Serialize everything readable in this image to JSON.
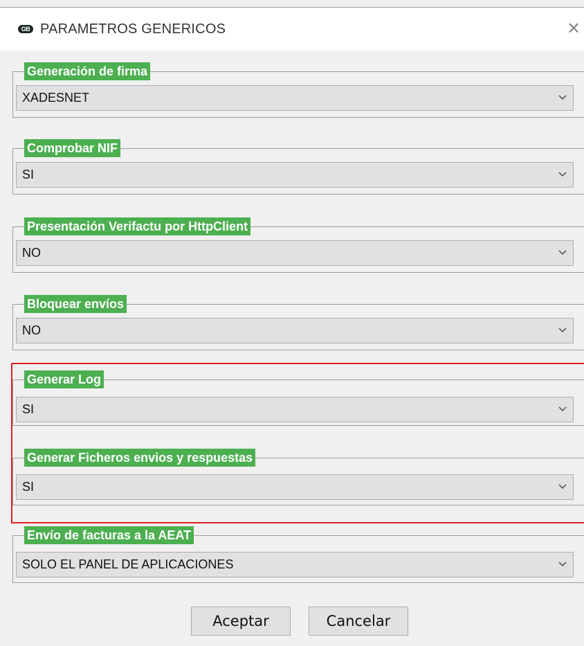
{
  "window": {
    "title": "PARAMETROS GENERICOS",
    "app_icon_text": "GB",
    "close_icon": "close-icon"
  },
  "fields": [
    {
      "label": "Generación de firma",
      "value": "XADESNET"
    },
    {
      "label": "Comprobar NIF",
      "value": "SI"
    },
    {
      "label": "Presentación Verifactu por HttpClient",
      "value": "NO"
    },
    {
      "label": "Bloquear envíos",
      "value": "NO"
    },
    {
      "label": "Generar Log",
      "value": "SI"
    },
    {
      "label": "Generar Ficheros envios y respuestas",
      "value": "SI"
    },
    {
      "label": "Envío de facturas a la AEAT",
      "value": "SOLO EL PANEL DE APLICACIONES"
    }
  ],
  "buttons": {
    "accept": "Aceptar",
    "cancel": "Cancelar"
  },
  "colors": {
    "legend_bg": "#4caf50",
    "highlight_border": "#e5201f"
  }
}
